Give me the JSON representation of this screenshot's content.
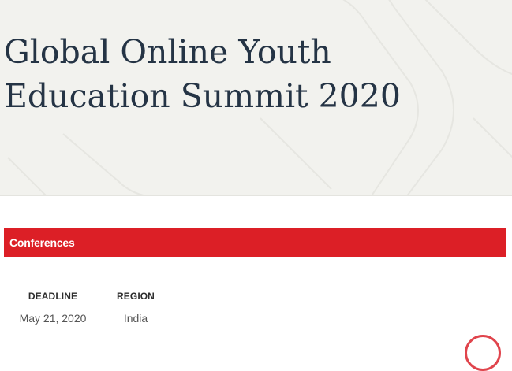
{
  "hero": {
    "title_line1": "Global Online Youth",
    "title_line2": "Education Summit 2020"
  },
  "category": {
    "label": "Conferences"
  },
  "details": {
    "deadline_label": "DEADLINE",
    "deadline_value": "May 21, 2020",
    "region_label": "REGION",
    "region_value": "India"
  },
  "colors": {
    "hero_bg": "#f2f2ee",
    "title": "#253445",
    "category_bar": "#dc1f26",
    "help_ring": "#e0444c"
  }
}
